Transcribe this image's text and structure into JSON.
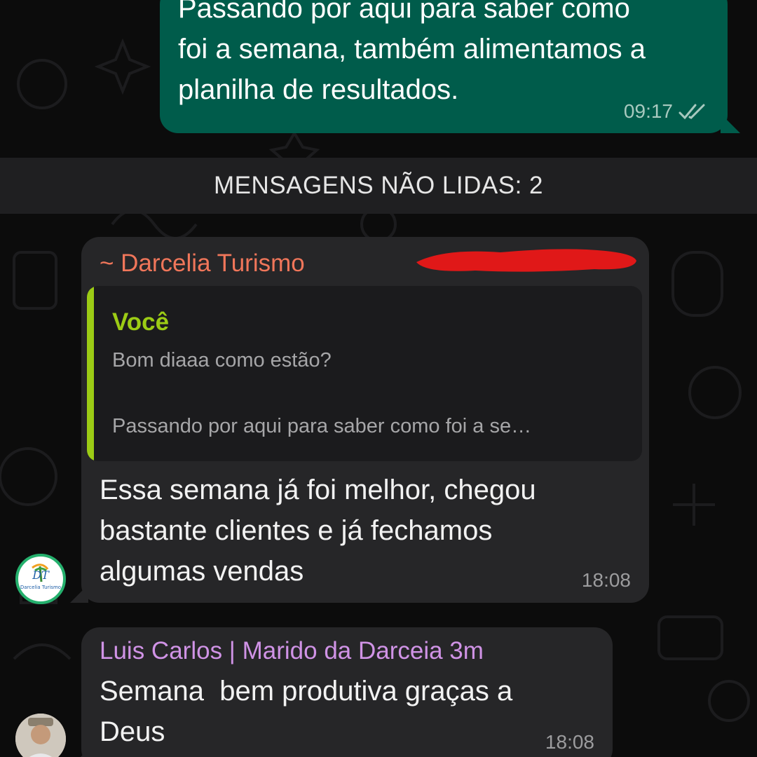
{
  "outgoing_message": {
    "text": "Passando por aqui para saber como\nfoi a semana, também alimentamos a\nplanilha de resultados.",
    "time": "09:17",
    "status_icon": "double-check-icon"
  },
  "unread_banner": {
    "label": "MENSAGENS NÃO LIDAS: 2"
  },
  "messages": [
    {
      "sender": "~ Darcelia Turismo",
      "sender_color": "#f0765a",
      "quoted": {
        "author": "Você",
        "line1": "Bom diaaa como estão?",
        "line2": "Passando por aqui para saber como foi a se…"
      },
      "text": "Essa semana já foi melhor, chegou\nbastante clientes e já fechamos\nalgumas vendas",
      "time": "18:08",
      "avatar_text": "Darcelia Turismo"
    },
    {
      "sender": "Luis Carlos | Marido da Darceia 3m",
      "sender_color": "#d093e6",
      "text": "Semana  bem produtiva graças a\nDeus",
      "time": "18:08"
    }
  ],
  "colors": {
    "outgoing_bubble": "#005c4b",
    "incoming_bubble": "#262628",
    "quote_accent": "#9ccc15",
    "background": "#0c0c0c"
  }
}
